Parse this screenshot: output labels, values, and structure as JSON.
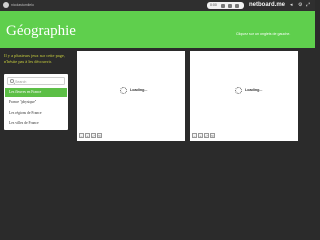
{
  "topbar": {
    "username": "nicolastumilelo",
    "status_time": "0:00",
    "brand": "netboard.me",
    "icons": [
      "notification-icon",
      "settings-icon",
      "fullscreen-icon"
    ]
  },
  "header": {
    "title": "Géographie",
    "subtitle": "Cliquez sur un onglets de gauche.",
    "bg_color": "#5fcf4d"
  },
  "sidebar": {
    "intro": "Il y a plusieurs jeux sur cette page, n'hésite pas à les découvrir.",
    "search_placeholder": "Search",
    "items": [
      {
        "label": "Les fleuves en France",
        "active": true
      },
      {
        "label": "France \"physique\"",
        "active": false
      },
      {
        "label": "Les régions de France",
        "active": false
      },
      {
        "label": "Les villes de France",
        "active": false
      }
    ],
    "accent_color": "#5cbf46"
  },
  "panels": [
    {
      "loading_text": "Loading..."
    },
    {
      "loading_text": "Loading..."
    }
  ],
  "colors": {
    "intro_text": "#c9cf3e",
    "page_bg": "#2b2b2b"
  }
}
